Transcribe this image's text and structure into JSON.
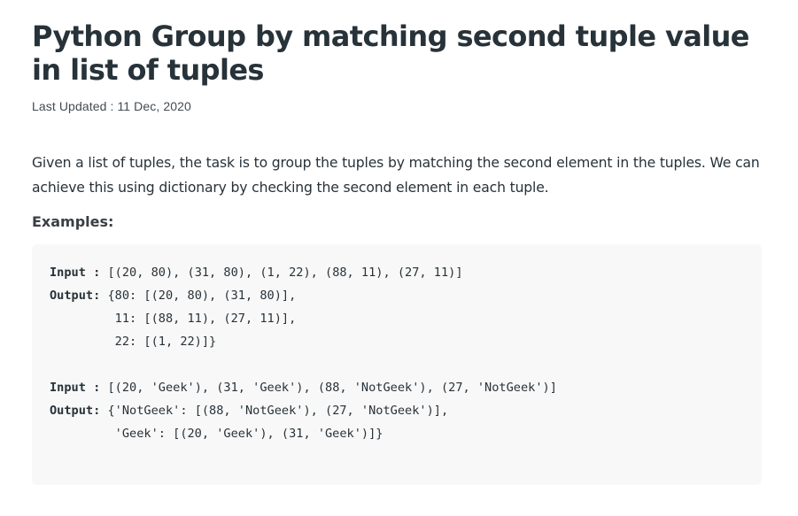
{
  "article": {
    "title": "Python Group by matching second tuple value in list of tuples",
    "last_updated": "Last Updated : 11 Dec, 2020",
    "intro": "Given a list of tuples, the task is to group the tuples by matching the second element in the tuples. We can achieve this using dictionary by checking the second element in each tuple.",
    "examples_heading": "Examples:"
  },
  "code": {
    "example1": {
      "input_label": "Input :",
      "input_value": " [(20, 80), (31, 80), (1, 22), (88, 11), (27, 11)]",
      "output_label": "Output:",
      "output_lines": [
        " {80: [(20, 80), (31, 80)],",
        "         11: [(88, 11), (27, 11)],",
        "         22: [(1, 22)]}"
      ]
    },
    "example2": {
      "input_label": "Input :",
      "input_value": " [(20, 'Geek'), (31, 'Geek'), (88, 'NotGeek'), (27, 'NotGeek')]",
      "output_label": "Output:",
      "output_lines": [
        " {'NotGeek': [(88, 'NotGeek'), (27, 'NotGeek')],",
        "         'Geek': [(20, 'Geek'), (31, 'Geek')]}"
      ]
    }
  }
}
